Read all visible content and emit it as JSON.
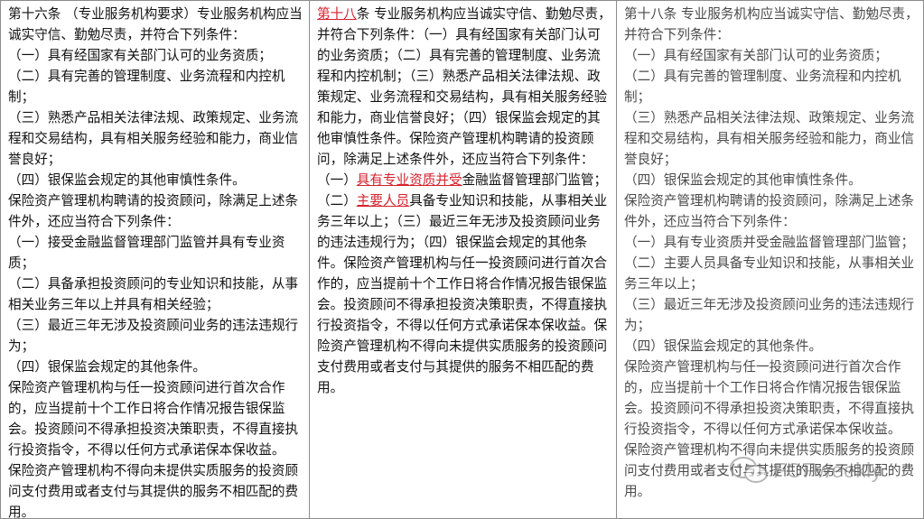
{
  "col1": {
    "heading": "第十六条 （专业服务机构要求）专业服务机构应当诚实守信、勤勉尽责，并符合下列条件：",
    "items": [
      "（一）具有经国家有关部门认可的业务资质；",
      "（二）具有完善的管理制度、业务流程和内控机制；",
      "（三）熟悉产品相关法律法规、政策规定、业务流程和交易结构，具有相关服务经验和能力，商业信誉良好；",
      "（四）银保监会规定的其他审慎性条件。",
      "保险资产管理机构聘请的投资顾问，除满足上述条件外，还应当符合下列条件：",
      "（一）接受金融监督管理部门监管并具有专业资质；",
      "（二）具备承担投资顾问的专业知识和技能，从事相关业务三年以上并具有相关经验；",
      "（三）最近三年无涉及投资顾问业务的违法违规行为；",
      "（四）银保监会规定的其他条件。",
      "保险资产管理机构与任一投资顾问进行首次合作的，应当提前十个工作日将合作情况报告银保监会。投资顾问不得承担投资决策职责，不得直接执行投资指令，不得以任何方式承诺保本保收益。",
      "保险资产管理机构不得向未提供实质服务的投资顾问支付费用或者支付与其提供的服务不相匹配的费用。"
    ]
  },
  "col2": {
    "article_label": "第十八",
    "text1": "条 专业服务机构应当诚实守信、勤勉尽责，并符合下列条件：（一）具有经国家有关部门认可的业务资质；（二）具有完善的管理制度、业务流程和内控机制；（三）熟悉产品相关法律法规、政策规定、业务流程和交易结构，具有相关服务经验和能力，商业信誉良好；（四）银保监会规定的其他审慎性条件。保险资产管理机构聘请的投资顾问，除满足上述条件外，还应当符合下列条件：（一）",
    "insert1": "具有专业资质并受",
    "text2": "金融监督管理部门监管；（二）",
    "insert2": "主要人员",
    "text3": "具备专业知识和技能，从事相关业务三年以上；（三）最近三年无涉及投资顾问业务的违法违规行为；（四）银保监会规定的其他条件。保险资产管理机构与任一投资顾问进行首次合作的，应当提前十个工作日将合作情况报告银保监会。投资顾问不得承担投资决策职责，不得直接执行投资指令，不得以任何方式承诺保本保收益。保险资产管理机构不得向未提供实质服务的投资顾问支付费用或者支付与其提供的服务不相匹配的费用。"
  },
  "col3": {
    "heading": "第十八条 专业服务机构应当诚实守信、勤勉尽责，并符合下列条件：",
    "items": [
      "（一）具有经国家有关部门认可的业务资质；",
      "（二）具有完善的管理制度、业务流程和内控机制；",
      "（三）熟悉产品相关法律法规、政策规定、业务流程和交易结构，具有相关服务经验和能力，商业信誉良好；",
      "（四）银保监会规定的其他审慎性条件。",
      "保险资产管理机构聘请的投资顾问，除满足上述条件外，还应当符合下列条件：",
      "（一）具有专业资质并受金融监督管理部门监管；",
      "（二）主要人员具备专业知识和技能，从事相关业务三年以上；",
      "（三）最近三年无涉及投资顾问业务的违法违规行为；",
      "（四）银保监会规定的其他条件。",
      "保险资产管理机构与任一投资顾问进行首次合作的，应当提前十个工作日将合作情况报告银保监会。投资顾问不得承担投资决策职责，不得直接执行投资指令，不得以任何方式承诺保本保收益。",
      "保险资产管理机构不得向未提供实质服务的投资顾问支付费用或者支付与其提供的服务不相匹配的费用。"
    ]
  },
  "watermark": {
    "text": "FOFweekly",
    "icon": "wechat-logo-icon"
  },
  "colors": {
    "accent_red": "#d8212e",
    "border": "#8c8c8c"
  }
}
